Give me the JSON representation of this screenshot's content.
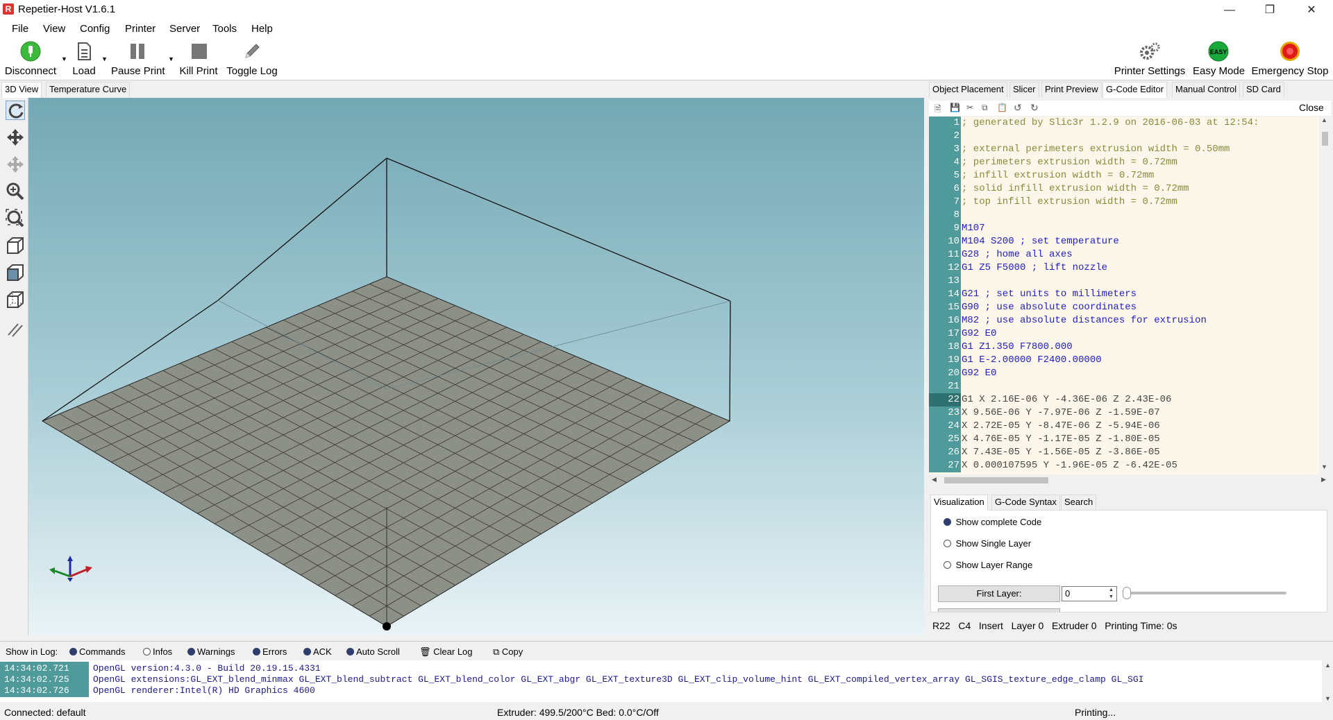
{
  "window": {
    "title": "Repetier-Host V1.6.1",
    "icon_letter": "R"
  },
  "menu": [
    "File",
    "View",
    "Config",
    "Printer",
    "Server",
    "Tools",
    "Help"
  ],
  "toolbar": {
    "disconnect": "Disconnect",
    "load": "Load",
    "pause": "Pause Print",
    "kill": "Kill Print",
    "toggle_log": "Toggle Log",
    "printer_settings": "Printer Settings",
    "easy_mode": "Easy Mode",
    "easy_badge": "EASY",
    "emergency": "Emergency Stop"
  },
  "left_tabs": [
    "3D View",
    "Temperature Curve"
  ],
  "right_tabs": [
    "Object Placement",
    "Slicer",
    "Print Preview",
    "G-Code Editor",
    "Manual Control",
    "SD Card"
  ],
  "editor": {
    "close": "Close",
    "current_line": 22,
    "lines": [
      {
        "n": "1",
        "t": "; generated by Slic3r 1.2.9 on 2016-06-03 at 12:54:",
        "c": "cm"
      },
      {
        "n": "2",
        "t": "",
        "c": "cm"
      },
      {
        "n": "3",
        "t": "; external perimeters extrusion width = 0.50mm",
        "c": "cm"
      },
      {
        "n": "4",
        "t": "; perimeters extrusion width = 0.72mm",
        "c": "cm"
      },
      {
        "n": "5",
        "t": "; infill extrusion width = 0.72mm",
        "c": "cm"
      },
      {
        "n": "6",
        "t": "; solid infill extrusion width = 0.72mm",
        "c": "cm"
      },
      {
        "n": "7",
        "t": "; top infill extrusion width = 0.72mm",
        "c": "cm"
      },
      {
        "n": "8",
        "t": "",
        "c": "cm"
      },
      {
        "n": "9",
        "t": "M107",
        "c": "kw"
      },
      {
        "n": "10",
        "t": "M104 S200 ; set temperature",
        "c": "kw"
      },
      {
        "n": "11",
        "t": "G28 ; home all axes",
        "c": "kw"
      },
      {
        "n": "12",
        "t": "G1 Z5 F5000 ; lift nozzle",
        "c": "kw"
      },
      {
        "n": "13",
        "t": "",
        "c": "kw"
      },
      {
        "n": "14",
        "t": "G21 ; set units to millimeters",
        "c": "kw"
      },
      {
        "n": "15",
        "t": "G90 ; use absolute coordinates",
        "c": "kw"
      },
      {
        "n": "16",
        "t": "M82 ; use absolute distances for extrusion",
        "c": "kw"
      },
      {
        "n": "17",
        "t": "G92 E0",
        "c": "kw"
      },
      {
        "n": "18",
        "t": "G1 Z1.350 F7800.000",
        "c": "kw"
      },
      {
        "n": "19",
        "t": "G1 E-2.00000 F2400.00000",
        "c": "kw"
      },
      {
        "n": "20",
        "t": "G92 E0",
        "c": "kw"
      },
      {
        "n": "21",
        "t": "",
        "c": "kw"
      },
      {
        "n": "22",
        "t": "G1 X 2.16E-06 Y -4.36E-06 Z 2.43E-06",
        "c": "plain"
      },
      {
        "n": "23",
        "t": "X 9.56E-06 Y -7.97E-06 Z -1.59E-07",
        "c": "plain"
      },
      {
        "n": "24",
        "t": "X 2.72E-05 Y -8.47E-06 Z -5.94E-06",
        "c": "plain"
      },
      {
        "n": "25",
        "t": "X 4.76E-05 Y -1.17E-05 Z -1.80E-05",
        "c": "plain"
      },
      {
        "n": "26",
        "t": "X 7.43E-05 Y -1.56E-05 Z -3.86E-05",
        "c": "plain"
      },
      {
        "n": "27",
        "t": "X 0.000107595 Y -1.96E-05 Z -6.42E-05",
        "c": "plain"
      }
    ]
  },
  "viz_tabs": [
    "Visualization",
    "G-Code Syntax",
    "Search"
  ],
  "visualization": {
    "options": [
      "Show complete Code",
      "Show Single Layer",
      "Show Layer Range"
    ],
    "selected": 0,
    "first_layer_label": "First Layer:",
    "first_layer_value": "0"
  },
  "editor_status": "R22   C4   Insert   Layer 0   Extruder 0   Printing Time: 0s",
  "log": {
    "show_label": "Show in Log:",
    "options": [
      {
        "label": "Commands",
        "on": true
      },
      {
        "label": "Infos",
        "on": false
      },
      {
        "label": "Warnings",
        "on": true
      },
      {
        "label": "Errors",
        "on": true
      },
      {
        "label": "ACK",
        "on": true
      },
      {
        "label": "Auto Scroll",
        "on": true
      }
    ],
    "clear": "Clear Log",
    "copy": "Copy",
    "rows": [
      {
        "time": "14:34:02.721",
        "msg": "OpenGL version:4.3.0 - Build 20.19.15.4331"
      },
      {
        "time": "14:34:02.725",
        "msg": "OpenGL extensions:GL_EXT_blend_minmax GL_EXT_blend_subtract GL_EXT_blend_color GL_EXT_abgr GL_EXT_texture3D GL_EXT_clip_volume_hint GL_EXT_compiled_vertex_array GL_SGIS_texture_edge_clamp GL_SGI"
      },
      {
        "time": "14:34:02.726",
        "msg": "OpenGL renderer:Intel(R) HD Graphics 4600"
      }
    ]
  },
  "status": {
    "connection": "Connected: default",
    "temps": "Extruder: 499.5/200°C Bed: 0.0°C/Off",
    "state": "Printing..."
  }
}
